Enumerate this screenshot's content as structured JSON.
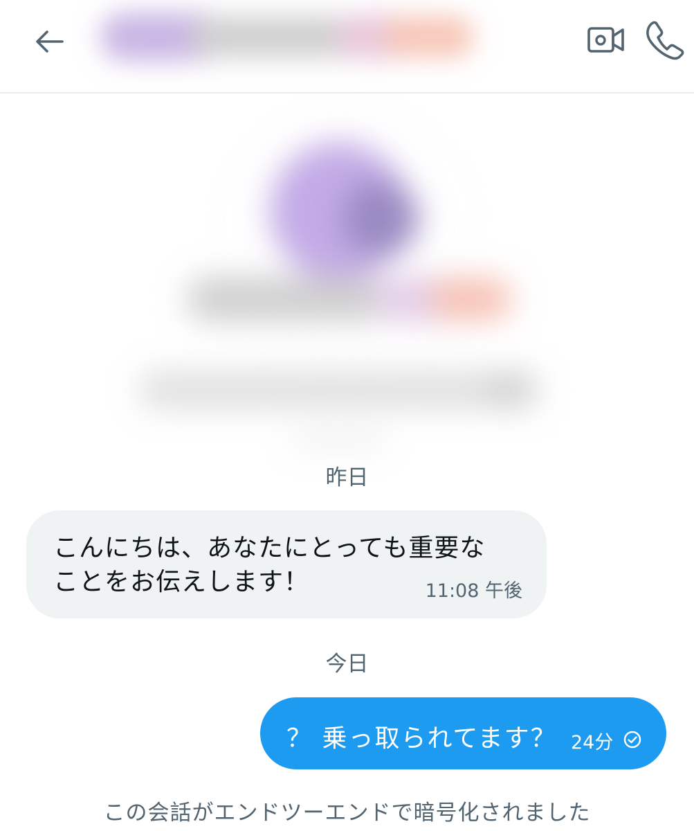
{
  "header": {
    "back_icon": "arrow-left-icon",
    "video_icon": "video-camera-icon",
    "phone_icon": "phone-icon"
  },
  "messages": {
    "date_yesterday": "昨日",
    "incoming": {
      "text_line1": "こんにちは、あなたにとっても重要な",
      "text_line2": "ことをお伝えします！",
      "time": "11:08 午後"
    },
    "date_today": "今日",
    "outgoing": {
      "text": "？ 乗っ取られてます？",
      "time": "24分",
      "status_icon": "check-circle-icon"
    }
  },
  "footer": {
    "encryption_note": "この会話がエンドツーエンドで暗号化されました"
  },
  "colors": {
    "accent": "#1d9bf0",
    "incoming_bubble": "#eff3f4",
    "secondary_text": "#536471"
  }
}
